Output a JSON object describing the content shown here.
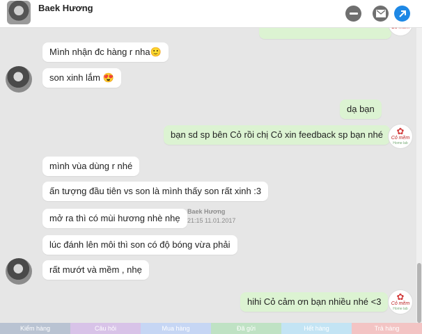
{
  "header": {
    "name": "Baek Hương"
  },
  "messages": [
    {
      "text": "Mình nhận đc hàng r nha",
      "emoji": "🙂"
    },
    {
      "text": "son xinh lắm",
      "emoji": "😍"
    },
    {
      "text": "dạ bạn"
    },
    {
      "text": "bạn sd sp bên Cỏ rồi chị Cỏ xin feedback sp bạn nhé"
    },
    {
      "text": "mình vùa dùng r nhé"
    },
    {
      "text": "ấn tượng đầu tiên vs son là mình thấy son rất xinh :3"
    },
    {
      "text": "mở ra thì có mùi hương nhè nhẹ"
    },
    {
      "text": "lúc đánh lên môi thì son có độ bóng vừa phải"
    },
    {
      "text": "rất mướt và mềm , nhẹ"
    },
    {
      "text": "hihi Cỏ cảm ơn bạn nhiều nhé <3"
    }
  ],
  "meta": {
    "sender": "Baek Hương",
    "timestamp": "21:15 11.01.2017"
  },
  "logo": {
    "text": "Cỏ mềm",
    "sub": "Home lab"
  },
  "footer_tabs": [
    {
      "label": "Kiểm hàng",
      "color": "#b9c3d2"
    },
    {
      "label": "Câu hỏi",
      "color": "#d8c3e8"
    },
    {
      "label": "Mua hàng",
      "color": "#c6d6f4"
    },
    {
      "label": "Đã gửi",
      "color": "#bfe2c4"
    },
    {
      "label": "Hết hàng",
      "color": "#c3e4f4"
    },
    {
      "label": "Trả hàng",
      "color": "#f3c4c4"
    }
  ],
  "colors": {
    "incoming_bubble": "#ffffff",
    "outgoing_bubble": "#dcf3d2",
    "chat_background": "#e6e6e6",
    "accent_blue": "#1e88e5"
  }
}
